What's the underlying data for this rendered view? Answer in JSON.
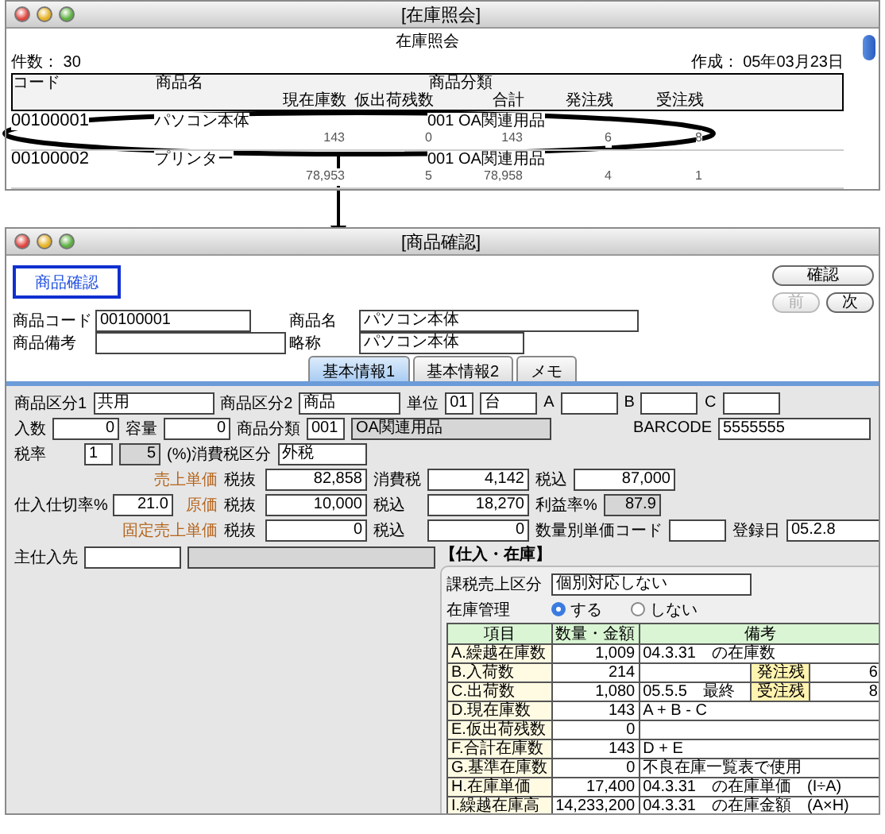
{
  "inventory_window": {
    "title": "[在庫照会]",
    "report_title": "在庫照会",
    "count": "件数： 30",
    "created": "作成： 05年03月23日",
    "columns_line1": [
      "コード",
      "商品名",
      "商品分類"
    ],
    "columns_line2": [
      "現在庫数",
      "仮出荷残数",
      "合計",
      "発注残",
      "受注残"
    ],
    "rows": [
      {
        "code": "00100001",
        "name": "パソコン本体",
        "category": "001 OA関連用品",
        "figures": [
          "143",
          "0",
          "143",
          "6",
          "8"
        ],
        "circled": true
      },
      {
        "code": "00100002",
        "name": "プリンター",
        "category": "001 OA関連用品",
        "figures": [
          "78,953",
          "5",
          "78,958",
          "4",
          "1"
        ],
        "circled": false
      }
    ]
  },
  "detail_window": {
    "title": "[商品確認]",
    "badge": "商品確認",
    "buttons": [
      {
        "label": "確認",
        "disabled": false
      },
      {
        "label": "前",
        "disabled": true
      },
      {
        "label": "次",
        "disabled": false
      }
    ],
    "product_code": {
      "label": "商品コード",
      "value": "00100001"
    },
    "product_name": {
      "label": "商品名",
      "value": "パソコン本体"
    },
    "product_note": {
      "label": "商品備考"
    },
    "short_name": {
      "label": "略称",
      "value": "パソコン本体"
    },
    "tabs": [
      {
        "label": "基本情報1",
        "selected": true
      },
      {
        "label": "基本情報2",
        "selected": false
      },
      {
        "label": "メモ",
        "selected": false
      }
    ],
    "class1": {
      "label": "商品区分1",
      "value": "共用"
    },
    "class2": {
      "label": "商品区分2",
      "value": "商品"
    },
    "unit": {
      "label": "単位",
      "code": "01",
      "value": "台"
    },
    "abc": [
      {
        "label": "A"
      },
      {
        "label": "B"
      },
      {
        "label": "C"
      }
    ],
    "quantity": {
      "label": "入数",
      "value": "0"
    },
    "capacity": {
      "label": "容量",
      "value": "0"
    },
    "category": {
      "label": "商品分類",
      "code": "001",
      "value": "OA関連用品"
    },
    "barcode": {
      "label": "BARCODE",
      "value": "5555555"
    },
    "tax_rate": {
      "label": "税率",
      "code": "1",
      "value": "5"
    },
    "tax_type": {
      "label": "(%)消費税区分",
      "value": "外税"
    },
    "prices": [
      {
        "label": "売上単価",
        "cells": [
          {
            "label": "税抜",
            "value": "82,858",
            "readonly": false
          },
          {
            "label": "消費税",
            "value": "4,142",
            "readonly": false
          },
          {
            "label": "税込",
            "value": "87,000",
            "readonly": false
          }
        ]
      },
      {
        "label": "原価",
        "prefix": {
          "label": "仕入仕切率%",
          "value": "21.0"
        },
        "cells": [
          {
            "label": "税抜",
            "value": "10,000",
            "readonly": false
          },
          {
            "label": "税込",
            "value": "18,270",
            "readonly": false
          },
          {
            "label": "利益率%",
            "value": "87.9",
            "readonly": true
          }
        ]
      },
      {
        "label": "固定売上単価",
        "suffix": {
          "label": "登録日",
          "value": "05.2.8"
        },
        "cells": [
          {
            "label": "税抜",
            "value": "0",
            "readonly": false
          },
          {
            "label": "税込",
            "value": "0",
            "readonly": false
          },
          {
            "label": "数量別単価コード",
            "readonly": false
          }
        ]
      }
    ],
    "supplier": {
      "label": "主仕入先"
    },
    "stock": {
      "heading": "【仕入・在庫】",
      "tax_sales": {
        "label": "課税売上区分",
        "value": "個別対応しない"
      },
      "stock_control": {
        "label": "在庫管理",
        "options": [
          {
            "label": "する",
            "selected": true
          },
          {
            "label": "しない",
            "selected": false
          }
        ]
      },
      "columns": [
        "項目",
        "数量・金額",
        "備考"
      ],
      "rows": [
        {
          "item": "A.繰越在庫数",
          "amount": "1,009",
          "notes": [
            "04.3.31",
            "の在庫数"
          ]
        },
        {
          "item": "B.入荷数",
          "amount": "214",
          "sub": {
            "label": "発注残",
            "value": "6"
          }
        },
        {
          "item": "C.出荷数",
          "amount": "1,080",
          "notes": [
            "05.5.5",
            "最終"
          ],
          "sub": {
            "label": "受注残",
            "value": "8"
          }
        },
        {
          "item": "D.現在庫数",
          "amount": "143",
          "notes": [
            "A + B - C"
          ]
        },
        {
          "item": "E.仮出荷残数",
          "amount": "0"
        },
        {
          "item": "F.合計在庫数",
          "amount": "143",
          "notes": [
            "D + E"
          ]
        },
        {
          "item": "G.基準在庫数",
          "amount": "0",
          "notes": [
            "不良在庫一覧表で使用"
          ]
        },
        {
          "item": "H.在庫単価",
          "amount": "17,400",
          "notes": [
            "04.3.31",
            "の在庫単価",
            "(I÷A)"
          ]
        },
        {
          "item": "I.繰越在庫高",
          "amount": "14,233,200",
          "notes": [
            "04.3.31",
            "の在庫金額",
            "(A×H)"
          ]
        }
      ]
    }
  }
}
